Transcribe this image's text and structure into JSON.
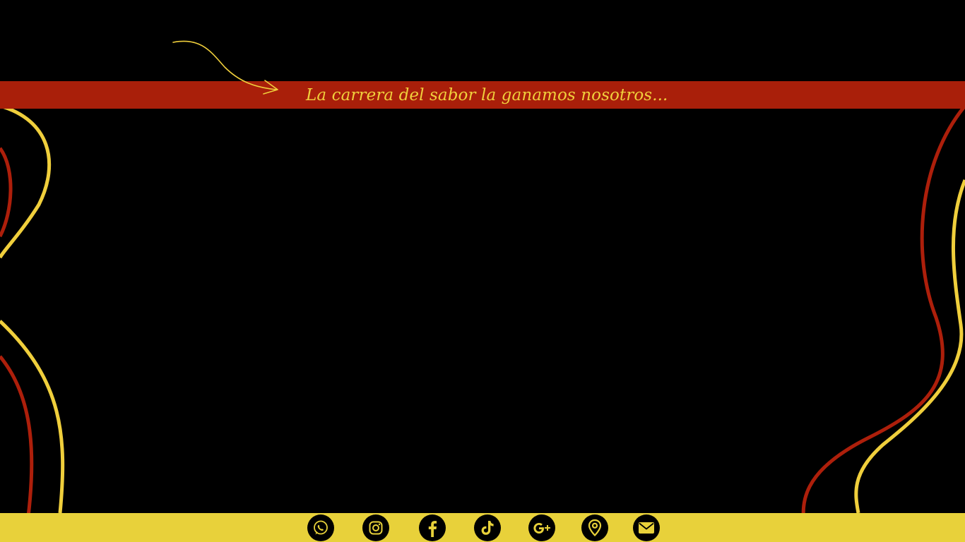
{
  "banner": {
    "tagline": "La carrera del sabor la ganamos nosotros..."
  },
  "footer": {
    "social_icons": [
      {
        "name": "whatsapp-icon"
      },
      {
        "name": "instagram-icon"
      },
      {
        "name": "facebook-icon",
        "glyph": "f"
      },
      {
        "name": "tiktok-icon"
      },
      {
        "name": "google-plus-icon",
        "glyph": "g+"
      },
      {
        "name": "location-pin-icon"
      },
      {
        "name": "email-icon"
      }
    ]
  },
  "colors": {
    "background": "#000000",
    "banner": "#a91f0a",
    "accent_yellow": "#f0cf3c",
    "footer": "#e8d13a",
    "curve_red": "#ad1f0b"
  }
}
